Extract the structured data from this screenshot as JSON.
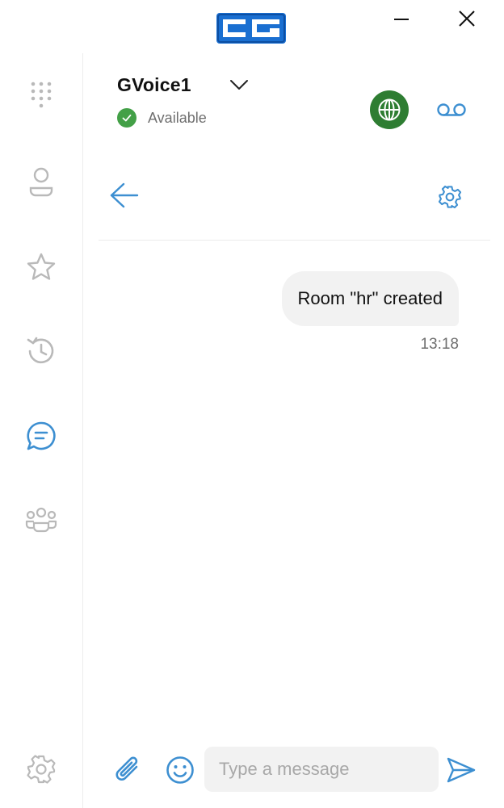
{
  "colors": {
    "accent": "#3d8fd1",
    "icon_gray": "#b9b9b9",
    "status_green": "#43a047",
    "globe_green": "#2e7d32",
    "logo_blue": "#1a6fd1"
  },
  "account": {
    "name": "GVoice1",
    "status": "Available"
  },
  "sidebar": {
    "items": [
      {
        "name": "dialpad",
        "icon": "dialpad-icon",
        "active": false
      },
      {
        "name": "contacts",
        "icon": "user-icon",
        "active": false
      },
      {
        "name": "favorites",
        "icon": "star-icon",
        "active": false
      },
      {
        "name": "history",
        "icon": "history-icon",
        "active": false
      },
      {
        "name": "chat",
        "icon": "chat-icon",
        "active": true
      },
      {
        "name": "groups",
        "icon": "group-icon",
        "active": false
      }
    ],
    "settings_icon": "gear-icon"
  },
  "conversation": {
    "messages": [
      {
        "text": "Room \"hr\" created",
        "time": "13:18"
      }
    ]
  },
  "composer": {
    "placeholder": "Type a message"
  }
}
